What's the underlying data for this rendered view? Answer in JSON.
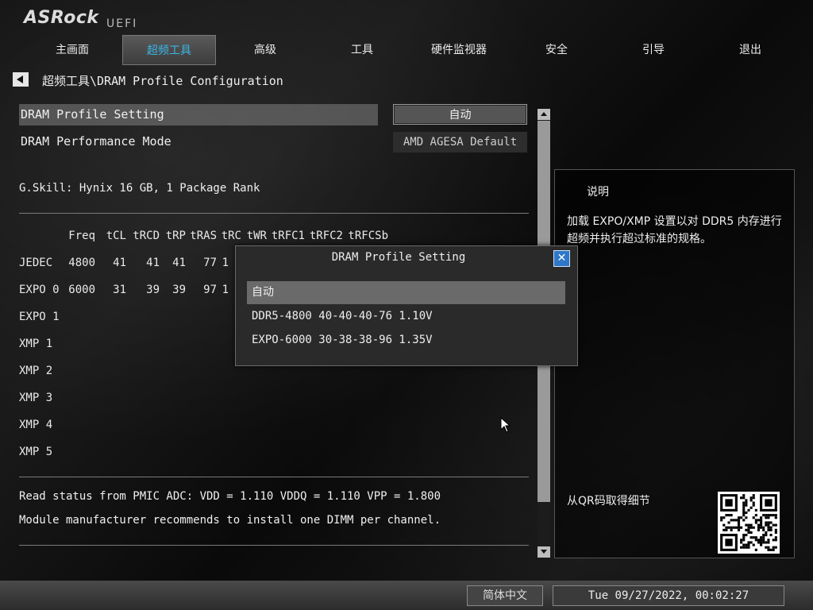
{
  "brand": {
    "logo": "ASRock",
    "sub": "UEFI"
  },
  "nav": {
    "tabs": [
      {
        "label": "主画面"
      },
      {
        "label": "超频工具"
      },
      {
        "label": "高级"
      },
      {
        "label": "工具"
      },
      {
        "label": "硬件监视器"
      },
      {
        "label": "安全"
      },
      {
        "label": "引导"
      },
      {
        "label": "退出"
      }
    ],
    "active_index": 1
  },
  "breadcrumb": "超频工具\\DRAM Profile Configuration",
  "settings": {
    "profile_label": "DRAM Profile Setting",
    "profile_value": "自动",
    "mode_label": "DRAM Performance Mode",
    "mode_value": "AMD AGESA Default"
  },
  "module_info": "G.Skill: Hynix 16 GB, 1 Package Rank",
  "timings": {
    "headers": [
      "Freq",
      "tCL",
      "tRCD",
      "tRP",
      "tRAS",
      "tRC",
      "tWR",
      "tRFC1",
      "tRFC2",
      "tRFCSb"
    ],
    "rows": [
      {
        "name": "JEDEC",
        "values": [
          "4800",
          "41",
          "41",
          "41",
          "77",
          "1"
        ]
      },
      {
        "name": "EXPO 0",
        "values": [
          "6000",
          "31",
          "39",
          "39",
          "97",
          "1"
        ]
      },
      {
        "name": "EXPO 1",
        "values": []
      },
      {
        "name": "XMP 1",
        "values": []
      },
      {
        "name": "XMP 2",
        "values": []
      },
      {
        "name": "XMP 3",
        "values": []
      },
      {
        "name": "XMP 4",
        "values": []
      },
      {
        "name": "XMP 5",
        "values": []
      }
    ]
  },
  "status": {
    "line1": "Read status from PMIC ADC: VDD = 1.110 VDDQ = 1.110 VPP = 1.800",
    "line2": "Module manufacturer recommends to install one DIMM per channel."
  },
  "description": {
    "title": "说明",
    "text": "加载 EXPO/XMP 设置以对 DDR5 内存进行超频并执行超过标准的规格。",
    "qr_label": "从QR码取得细节"
  },
  "modal": {
    "title": "DRAM Profile Setting",
    "options": [
      "自动",
      "DDR5-4800 40-40-40-76 1.10V",
      "EXPO-6000 30-38-38-96 1.35V"
    ],
    "selected_index": 0
  },
  "footer": {
    "language": "简体中文",
    "datetime": "Tue 09/27/2022, 00:02:27"
  },
  "colors": {
    "accent": "#3ab6e6",
    "close_button": "#2f78c8"
  }
}
